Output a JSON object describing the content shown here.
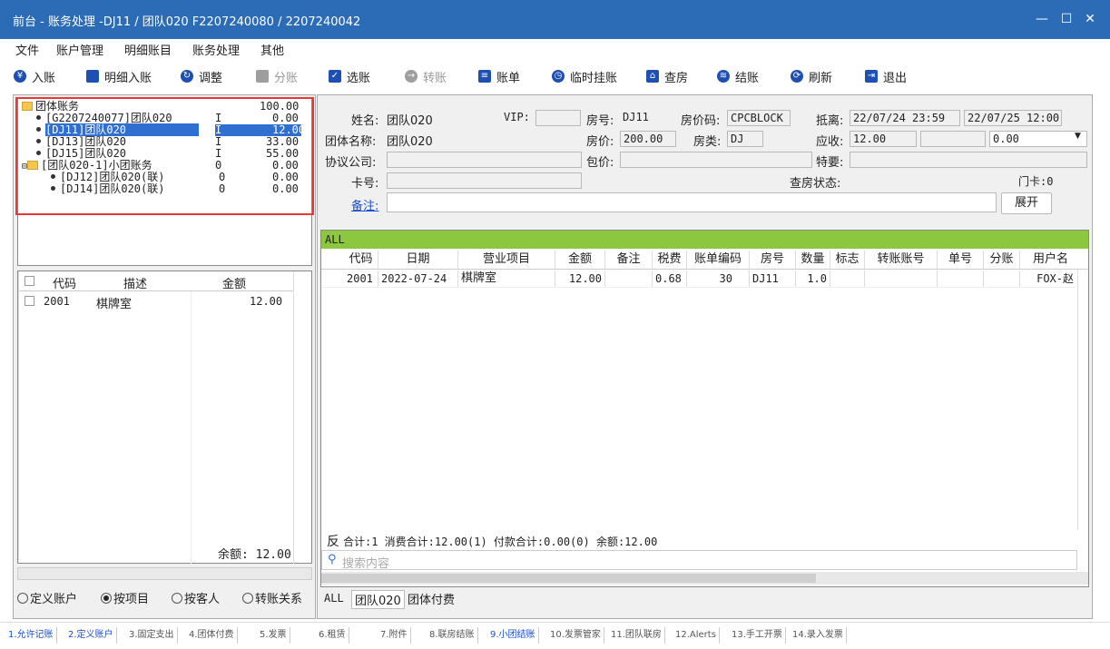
{
  "window": {
    "title": "前台 - 账务处理 -DJ11 / 团队020  F2207240080 / 2207240042",
    "minimize": "—",
    "maximize": "☐",
    "close": "✕"
  },
  "menu": [
    "文件",
    "账户管理",
    "明细账目",
    "账务处理",
    "其他"
  ],
  "toolbar": [
    {
      "label": "入账",
      "icon": "yen-icon",
      "enabled": true,
      "color": "#1e4fb3"
    },
    {
      "label": "明细入账",
      "icon": "card-icon",
      "enabled": true,
      "color": "#1e4fb3"
    },
    {
      "label": "调整",
      "icon": "adjust-icon",
      "enabled": true,
      "color": "#1e4fb3"
    },
    {
      "label": "分账",
      "icon": "split-icon",
      "enabled": false,
      "color": "#9e9e9e"
    },
    {
      "label": "选账",
      "icon": "select-icon",
      "enabled": true,
      "color": "#1e4fb3"
    },
    {
      "label": "转账",
      "icon": "transfer-icon",
      "enabled": false,
      "color": "#9e9e9e"
    },
    {
      "label": "账单",
      "icon": "bill-icon",
      "enabled": true,
      "color": "#1e4fb3"
    },
    {
      "label": "临时挂账",
      "icon": "clock-icon",
      "enabled": true,
      "color": "#1e4fb3"
    },
    {
      "label": "查房",
      "icon": "house-icon",
      "enabled": true,
      "color": "#1e4fb3"
    },
    {
      "label": "结账",
      "icon": "coins-icon",
      "enabled": true,
      "color": "#1e4fb3"
    },
    {
      "label": "刷新",
      "icon": "refresh-icon",
      "enabled": true,
      "color": "#1e4fb3"
    },
    {
      "label": "退出",
      "icon": "exit-icon",
      "enabled": true,
      "color": "#1e4fb3"
    }
  ],
  "tree": {
    "root": {
      "label": "团体账务",
      "amount": "100.00"
    },
    "rows": [
      {
        "label": "[G2207240077]团队020",
        "flag": "I",
        "amount": "0.00",
        "selected": false
      },
      {
        "label": "[DJ11]团队020",
        "flag": "I",
        "amount": "12.00",
        "selected": true
      },
      {
        "label": "[DJ13]团队020",
        "flag": "I",
        "amount": "33.00",
        "selected": false
      },
      {
        "label": "[DJ15]团队020",
        "flag": "I",
        "amount": "55.00",
        "selected": false
      },
      {
        "label": "[团队020-1]小团账务",
        "flag": "0",
        "amount": "0.00",
        "selected": false
      },
      {
        "label": "[DJ12]团队020(联)",
        "flag": "0",
        "amount": "0.00",
        "selected": false
      },
      {
        "label": "[DJ14]团队020(联)",
        "flag": "0",
        "amount": "0.00",
        "selected": false
      }
    ]
  },
  "item_table": {
    "headers": [
      "代码",
      "描述",
      "金额"
    ],
    "rows": [
      {
        "code": "2001",
        "desc": "棋牌室",
        "amount": "12.00"
      }
    ],
    "balance": "余额: 12.00"
  },
  "radios": [
    {
      "label": "定义账户",
      "checked": false
    },
    {
      "label": "按项目",
      "checked": true
    },
    {
      "label": "按客人",
      "checked": false
    },
    {
      "label": "转账关系",
      "checked": false
    }
  ],
  "info": {
    "name_label": "姓名:",
    "name": "团队020",
    "vip_label": "VIP:",
    "vip": "",
    "room_label": "房号:",
    "room": "DJ11",
    "rate_code_label": "房价码:",
    "rate_code": "CPCBLOCK",
    "arrive_label": "抵离:",
    "arrive": "22/07/24 23:59",
    "depart": "22/07/25 12:00",
    "group_label": "团体名称:",
    "group": "团队020",
    "price_label": "房价:",
    "price": "200.00",
    "room_type_label": "房类:",
    "room_type": "DJ",
    "receivable_label": "应收:",
    "receivable": "12.00",
    "receivable2": "",
    "receivable3": "0.00",
    "company_label": "协议公司:",
    "company": "",
    "package_label": "包价:",
    "package": "",
    "special_label": "特要:",
    "special": "",
    "card_label": "卡号:",
    "card": "",
    "inspect_label": "查房状态:",
    "doorcard": "门卡:0",
    "remark_label": "备注:",
    "remark": "",
    "expand": "展开"
  },
  "grid": {
    "filter": "ALL",
    "headers": [
      "代码",
      "日期",
      "营业项目",
      "金额",
      "备注",
      "税费",
      "账单编码",
      "房号",
      "数量",
      "标志",
      "转账账号",
      "单号",
      "分账",
      "用户名"
    ],
    "rows": [
      [
        "2001",
        "2022-07-24",
        "棋牌室",
        "12.00",
        "",
        "0.68",
        "30",
        "DJ11",
        "1.0",
        "",
        "",
        "",
        "",
        "FOX-赵"
      ]
    ],
    "summary_prefix": "反",
    "summary": "合计:1  消费合计:12.00(1)  付款合计:0.00(0)  余额:12.00",
    "search_placeholder": "搜索内容"
  },
  "sub_tabs": [
    "ALL",
    "团队020",
    "团体付费"
  ],
  "bottom_tabs": [
    {
      "label": "1.允许记账",
      "active": true
    },
    {
      "label": "2.定义账户",
      "active": true
    },
    {
      "label": "3.固定支出",
      "active": false
    },
    {
      "label": "4.团体付费",
      "active": false
    },
    {
      "label": "5.发票",
      "active": false
    },
    {
      "label": "6.租赁",
      "active": false
    },
    {
      "label": "7.附件",
      "active": false
    },
    {
      "label": "8.联房结账",
      "active": false
    },
    {
      "label": "9.小团结账",
      "active": true
    },
    {
      "label": "10.发票管家",
      "active": false
    },
    {
      "label": "11.团队联房",
      "active": false
    },
    {
      "label": "12.Alerts",
      "active": false
    },
    {
      "label": "13.手工开票",
      "active": false
    },
    {
      "label": "14.录入发票",
      "active": false
    }
  ],
  "colors": {
    "titlebar": "#2c6cb6",
    "filter_bar": "#8dc63f",
    "selection": "#2f6fd1",
    "highlight_box": "#e53935"
  }
}
